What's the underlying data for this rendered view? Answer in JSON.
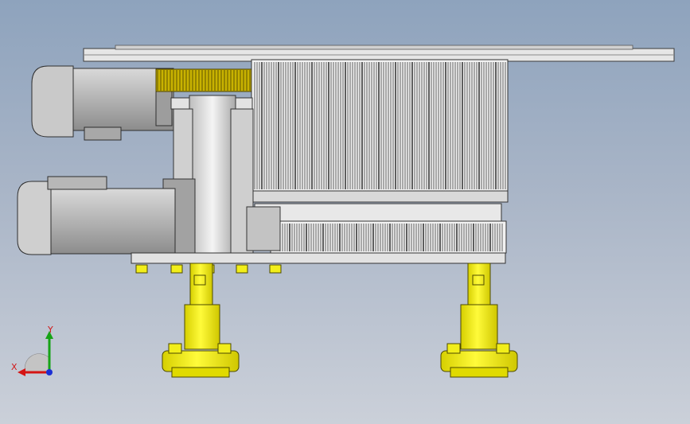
{
  "viewport": {
    "background_top": "#8ea3bd",
    "background_bottom": "#cbd0d9"
  },
  "colors": {
    "steel": "#e9e9e9",
    "steel_dark": "#6d6d6d",
    "gear": "#c9b300",
    "yellow_part": "#f2ee1a",
    "motor": "#bdbdbd"
  },
  "triad": {
    "x_label": "X",
    "y_label": "Y",
    "x_color": "#d41414",
    "y_color": "#16a316",
    "z_color": "#1b2fd4"
  }
}
